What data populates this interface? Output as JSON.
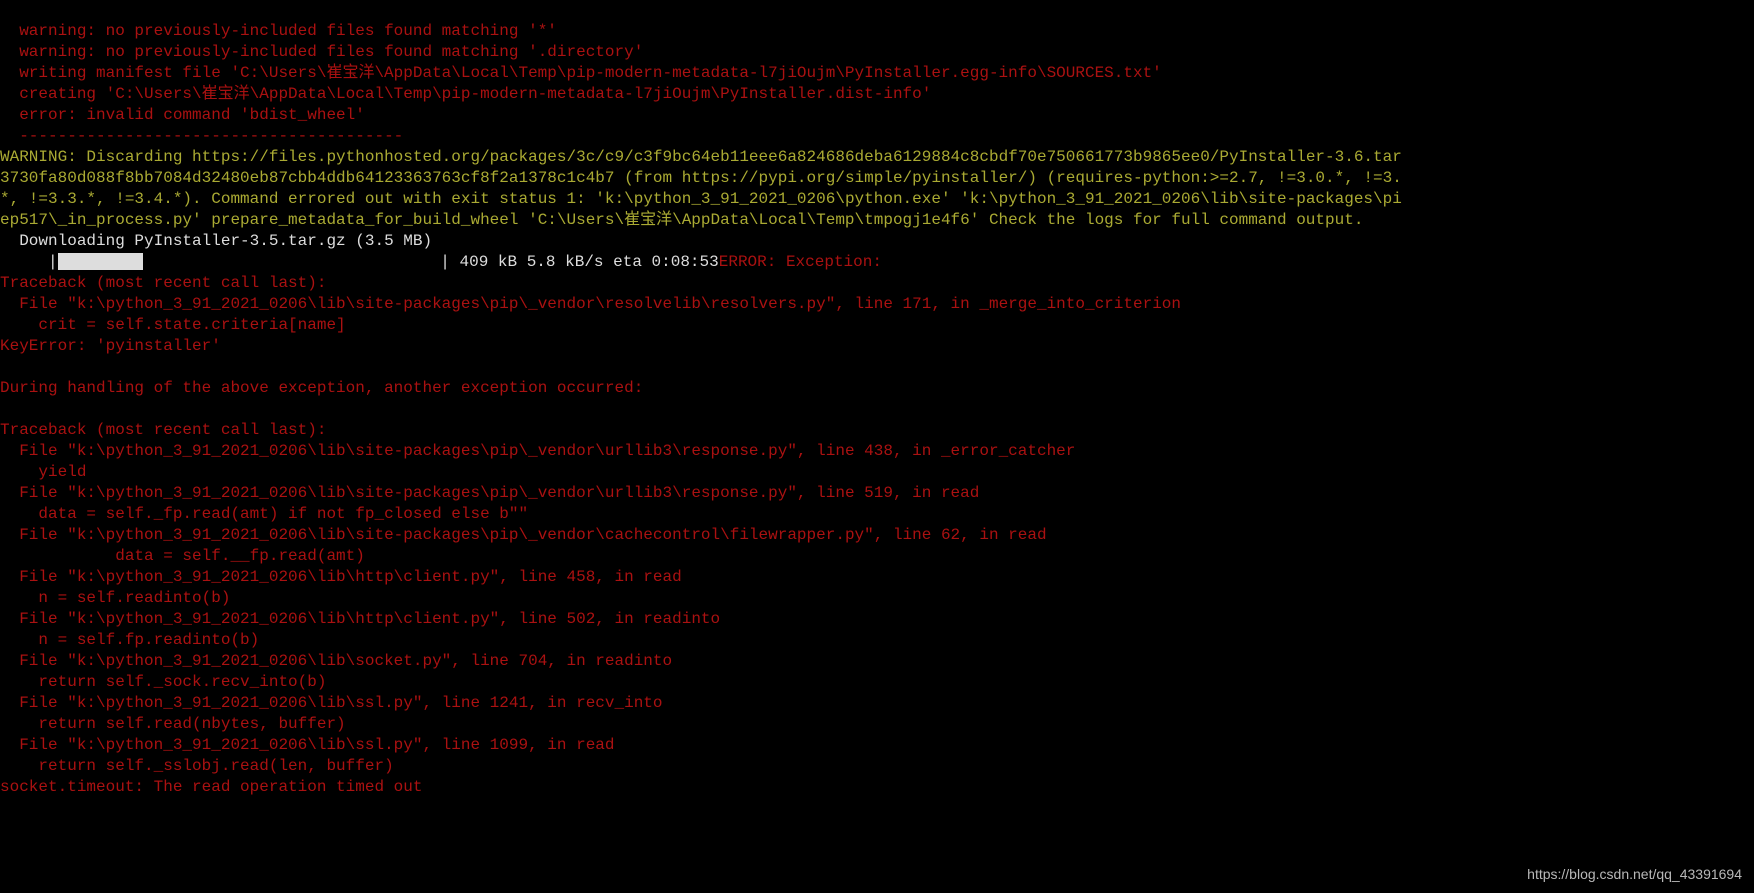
{
  "build_output": {
    "line1": "  warning: no previously-included files found matching '*'",
    "line2": "  warning: no previously-included files found matching '.directory'",
    "line3": "  writing manifest file 'C:\\Users\\崔宝洋\\AppData\\Local\\Temp\\pip-modern-metadata-l7jiOujm\\PyInstaller.egg-info\\SOURCES.txt'",
    "line4": "  creating 'C:\\Users\\崔宝洋\\AppData\\Local\\Temp\\pip-modern-metadata-l7jiOujm\\PyInstaller.dist-info'",
    "line5": "  error: invalid command 'bdist_wheel'",
    "line6": "  ----------------------------------------"
  },
  "warning": {
    "line1": "WARNING: Discarding https://files.pythonhosted.org/packages/3c/c9/c3f9bc64eb11eee6a824686deba6129884c8cbdf70e750661773b9865ee0/PyInstaller-3.6.tar",
    "line2": "3730fa80d088f8bb7084d32480eb87cbb4ddb64123363763cf8f2a1378c1c4b7 (from https://pypi.org/simple/pyinstaller/) (requires-python:>=2.7, !=3.0.*, !=3.",
    "line3": "*, !=3.3.*, !=3.4.*). Command errored out with exit status 1: 'k:\\python_3_91_2021_0206\\python.exe' 'k:\\python_3_91_2021_0206\\lib\\site-packages\\pi",
    "line4": "ep517\\_in_process.py' prepare_metadata_for_build_wheel 'C:\\Users\\崔宝洋\\AppData\\Local\\Temp\\tmpogj1e4f6' Check the logs for full command output."
  },
  "download": {
    "label": "  Downloading PyInstaller-3.5.tar.gz (3.5 MB)",
    "prefix": "     ",
    "pipe": "|",
    "stats": " 409 kB 5.8 kB/s eta 0:08:53"
  },
  "error_label": "ERROR: Exception:",
  "traceback1": {
    "header": "Traceback (most recent call last):",
    "file1": "  File \"k:\\python_3_91_2021_0206\\lib\\site-packages\\pip\\_vendor\\resolvelib\\resolvers.py\", line 171, in _merge_into_criterion",
    "code1": "    crit = self.state.criteria[name]",
    "keyerror": "KeyError: 'pyinstaller'"
  },
  "during": "During handling of the above exception, another exception occurred:",
  "traceback2": {
    "header": "Traceback (most recent call last):",
    "f1": "  File \"k:\\python_3_91_2021_0206\\lib\\site-packages\\pip\\_vendor\\urllib3\\response.py\", line 438, in _error_catcher",
    "c1": "    yield",
    "f2": "  File \"k:\\python_3_91_2021_0206\\lib\\site-packages\\pip\\_vendor\\urllib3\\response.py\", line 519, in read",
    "c2": "    data = self._fp.read(amt) if not fp_closed else b\"\"",
    "f3": "  File \"k:\\python_3_91_2021_0206\\lib\\site-packages\\pip\\_vendor\\cachecontrol\\filewrapper.py\", line 62, in read",
    "c3": "            data = self.__fp.read(amt)",
    "f4": "  File \"k:\\python_3_91_2021_0206\\lib\\http\\client.py\", line 458, in read",
    "c4": "    n = self.readinto(b)",
    "f5": "  File \"k:\\python_3_91_2021_0206\\lib\\http\\client.py\", line 502, in readinto",
    "c5": "    n = self.fp.readinto(b)",
    "f6": "  File \"k:\\python_3_91_2021_0206\\lib\\socket.py\", line 704, in readinto",
    "c6": "    return self._sock.recv_into(b)",
    "f7": "  File \"k:\\python_3_91_2021_0206\\lib\\ssl.py\", line 1241, in recv_into",
    "c7": "    return self.read(nbytes, buffer)",
    "f8": "  File \"k:\\python_3_91_2021_0206\\lib\\ssl.py\", line 1099, in read",
    "c8": "    return self._sslobj.read(len, buffer)",
    "timeout": "socket.timeout: The read operation timed out"
  },
  "watermark": "https://blog.csdn.net/qq_43391694"
}
